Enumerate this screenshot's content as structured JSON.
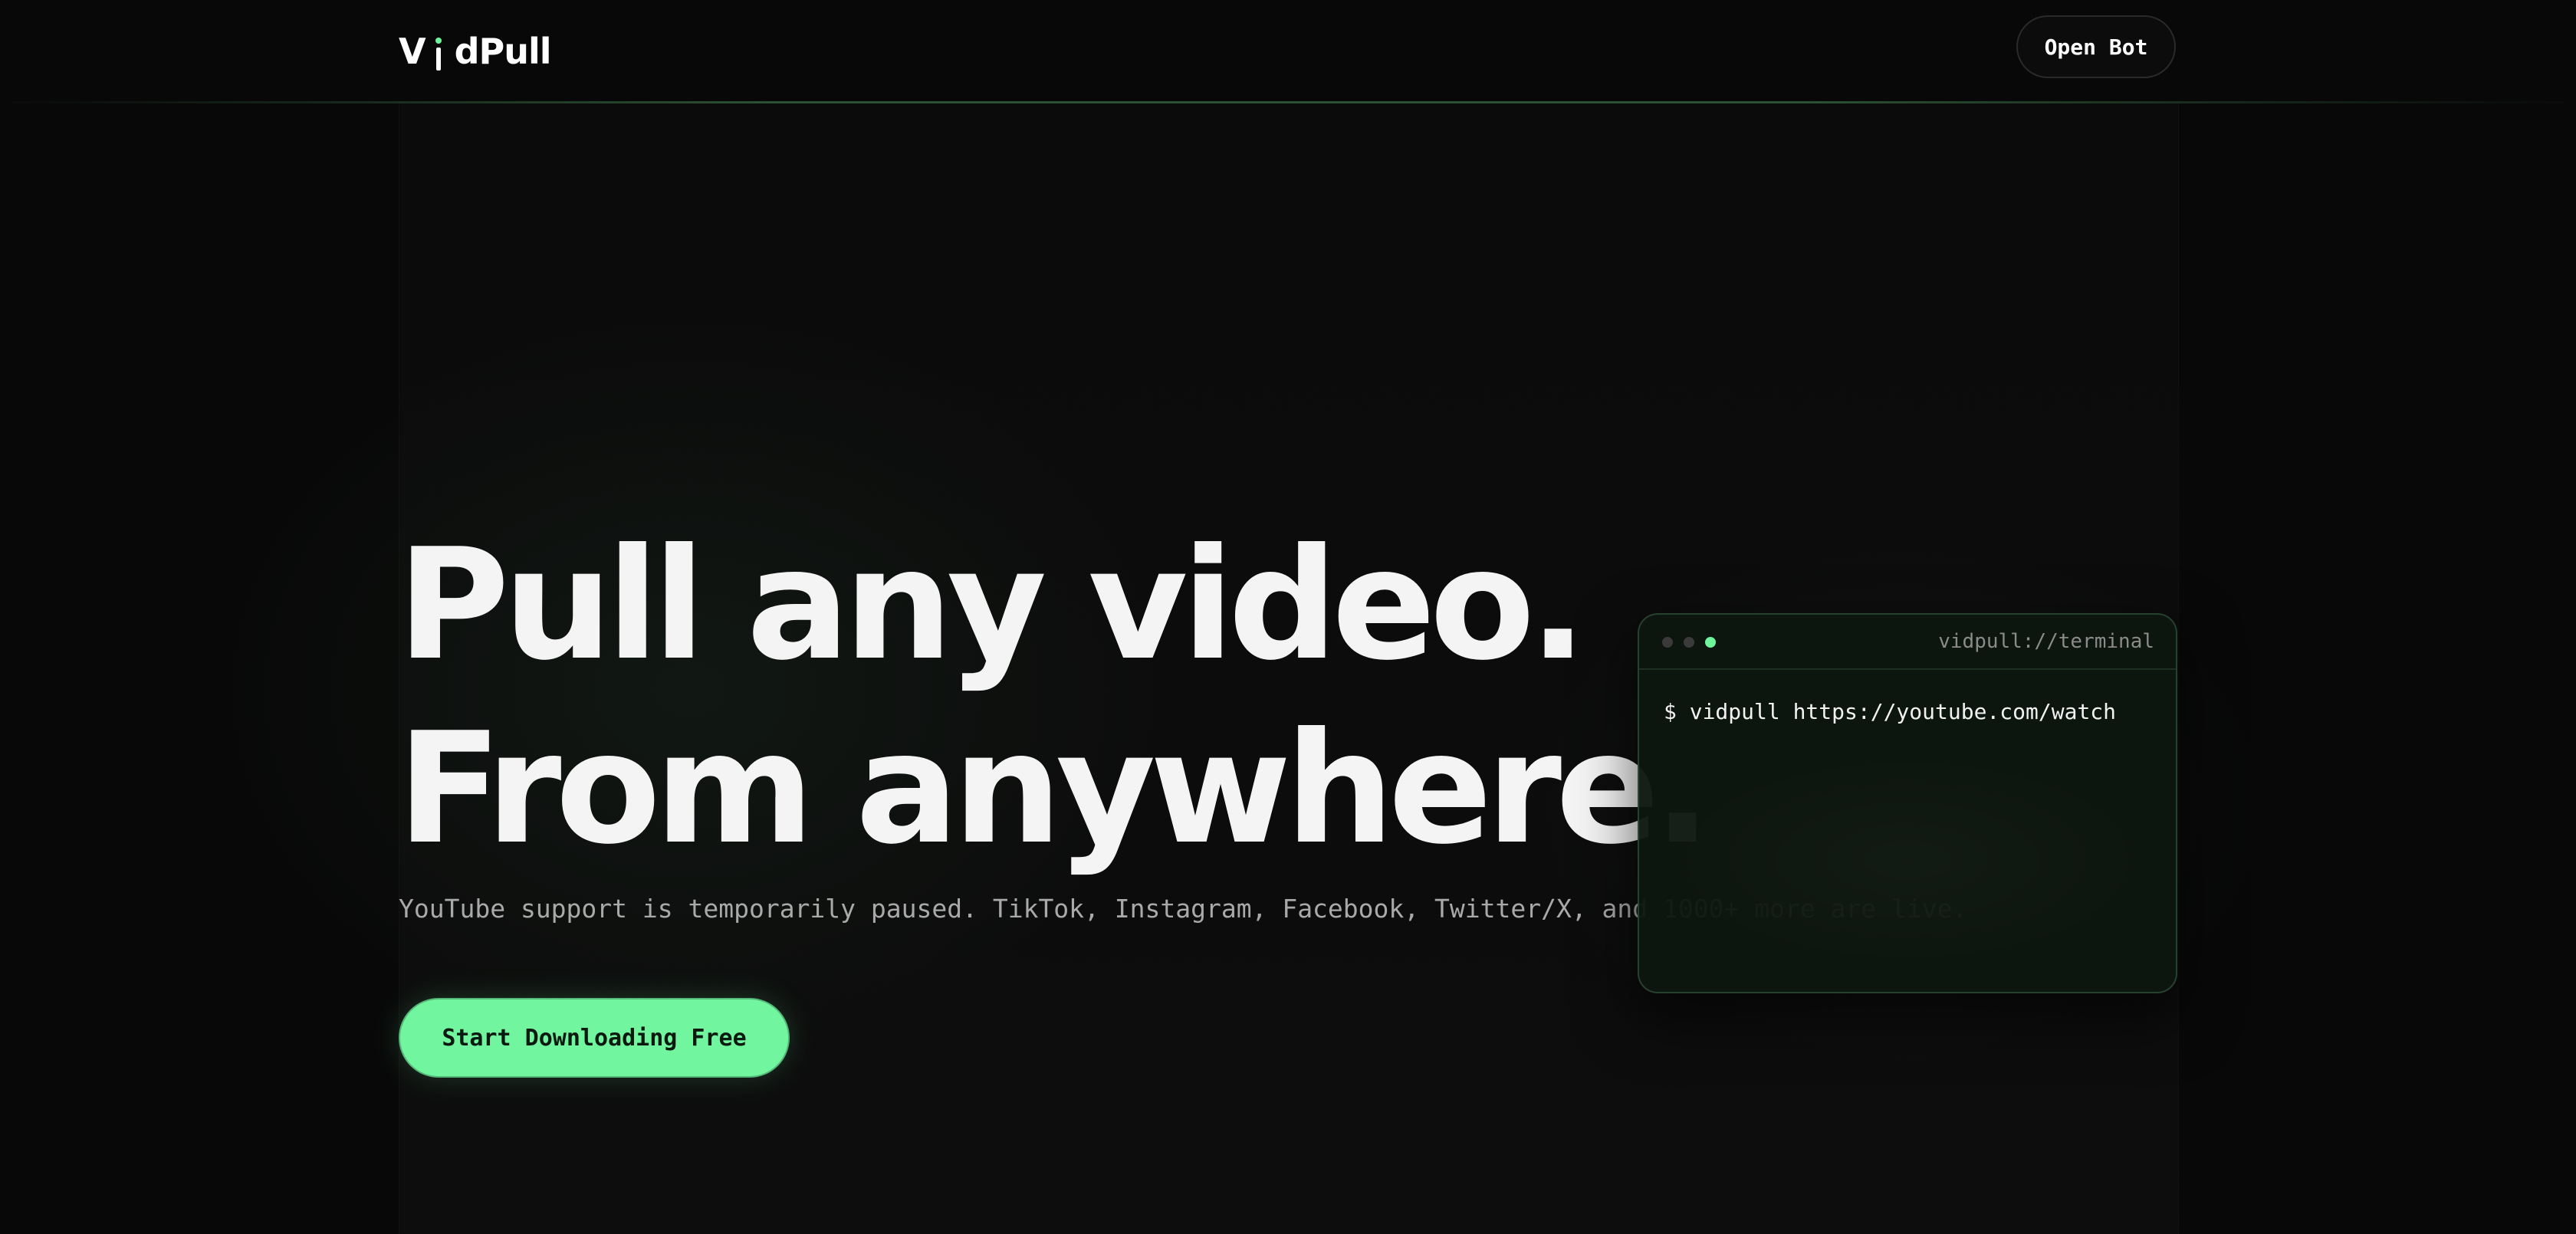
{
  "header": {
    "logo_prefix": "V",
    "logo_suffix": "dPull",
    "open_bot_label": "Open Bot"
  },
  "hero": {
    "headline_line1": "Pull any video.",
    "headline_line2": "From anywhere.",
    "subline": "YouTube support is temporarily paused. TikTok, Instagram, Facebook, Twitter/X, and 1000+ more are live.",
    "cta_label": "Start Downloading Free"
  },
  "terminal": {
    "title": "vidpull://terminal",
    "command": "$ vidpull https://youtube.com/watch"
  },
  "colors": {
    "accent": "#72f59f",
    "background": "#080808"
  }
}
